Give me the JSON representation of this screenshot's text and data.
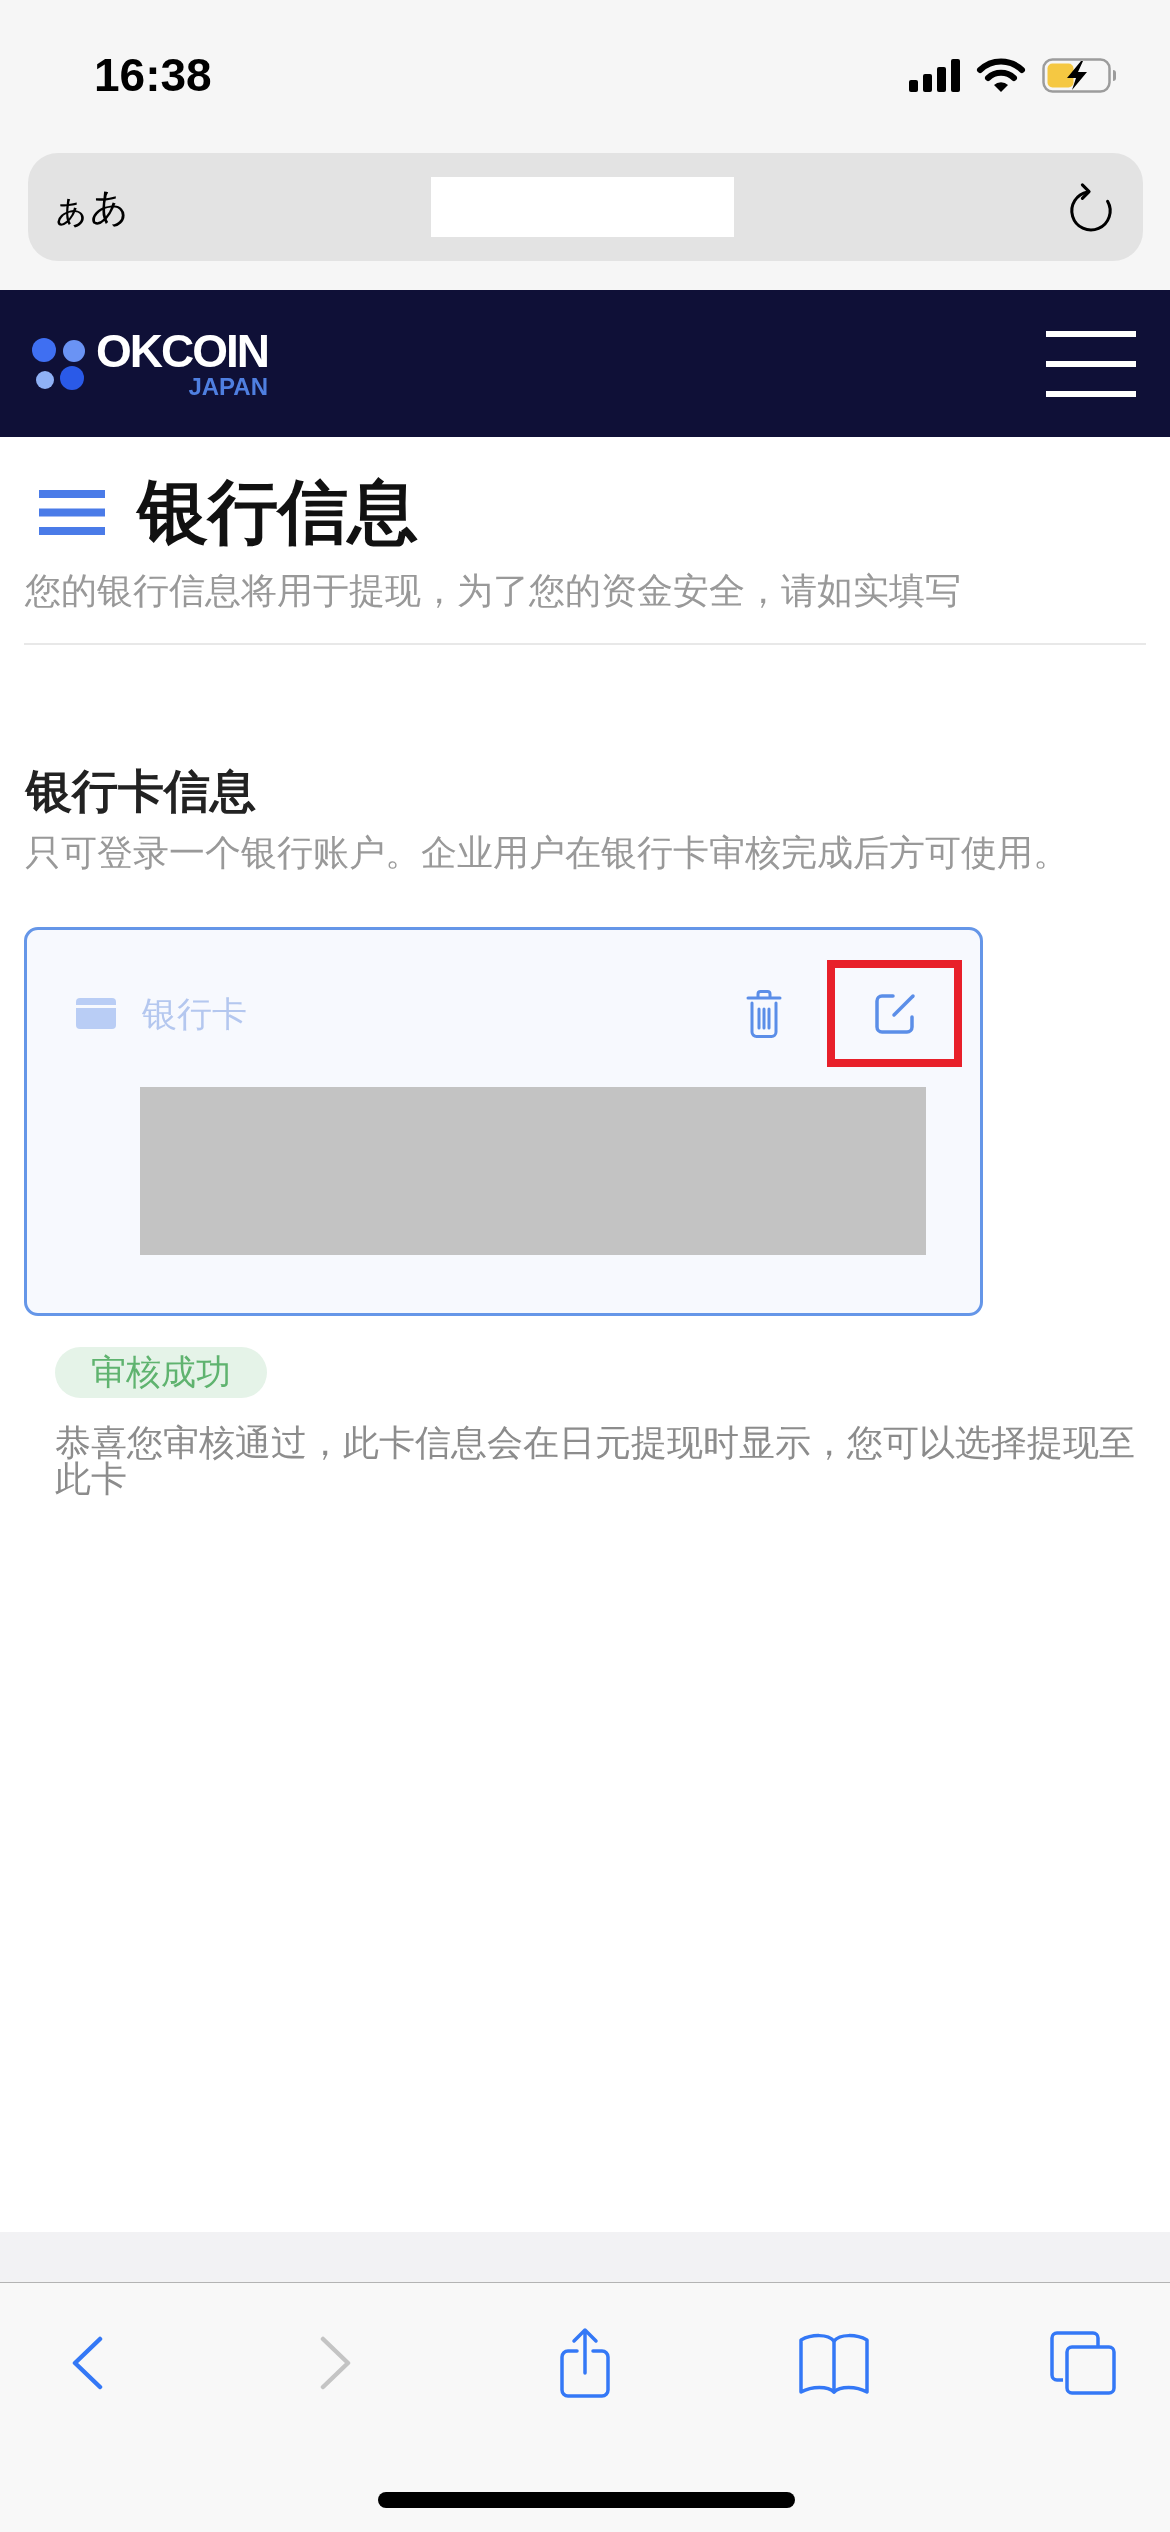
{
  "status_bar": {
    "time": "16:38"
  },
  "address_bar": {
    "text_size_button": "ぁあ"
  },
  "site_header": {
    "logo": {
      "wordmark": "OKCOIN",
      "subtitle": "JAPAN"
    }
  },
  "page_header": {
    "title": "银行信息",
    "subtitle": "您的银行信息将用于提现，为了您的资金安全，请如实填写"
  },
  "bank_card_section": {
    "title": "银行卡信息",
    "subtitle": "只可登录一个银行账户。企业用户在银行卡审核完成后方可使用。",
    "card": {
      "label": "银行卡",
      "actions": [
        {
          "kind": "delete",
          "highlighted": false
        },
        {
          "kind": "edit",
          "highlighted": true
        }
      ]
    },
    "review": {
      "badge": "审核成功",
      "message": "恭喜您审核通过，此卡信息会在日元提现时显示，您可以选择提现至此卡"
    }
  },
  "toolbar": {
    "buttons": [
      {
        "kind": "back",
        "disabled": false
      },
      {
        "kind": "forward",
        "disabled": true
      },
      {
        "kind": "share",
        "disabled": false
      },
      {
        "kind": "bookmarks",
        "disabled": false
      },
      {
        "kind": "tabs",
        "disabled": false
      }
    ]
  }
}
